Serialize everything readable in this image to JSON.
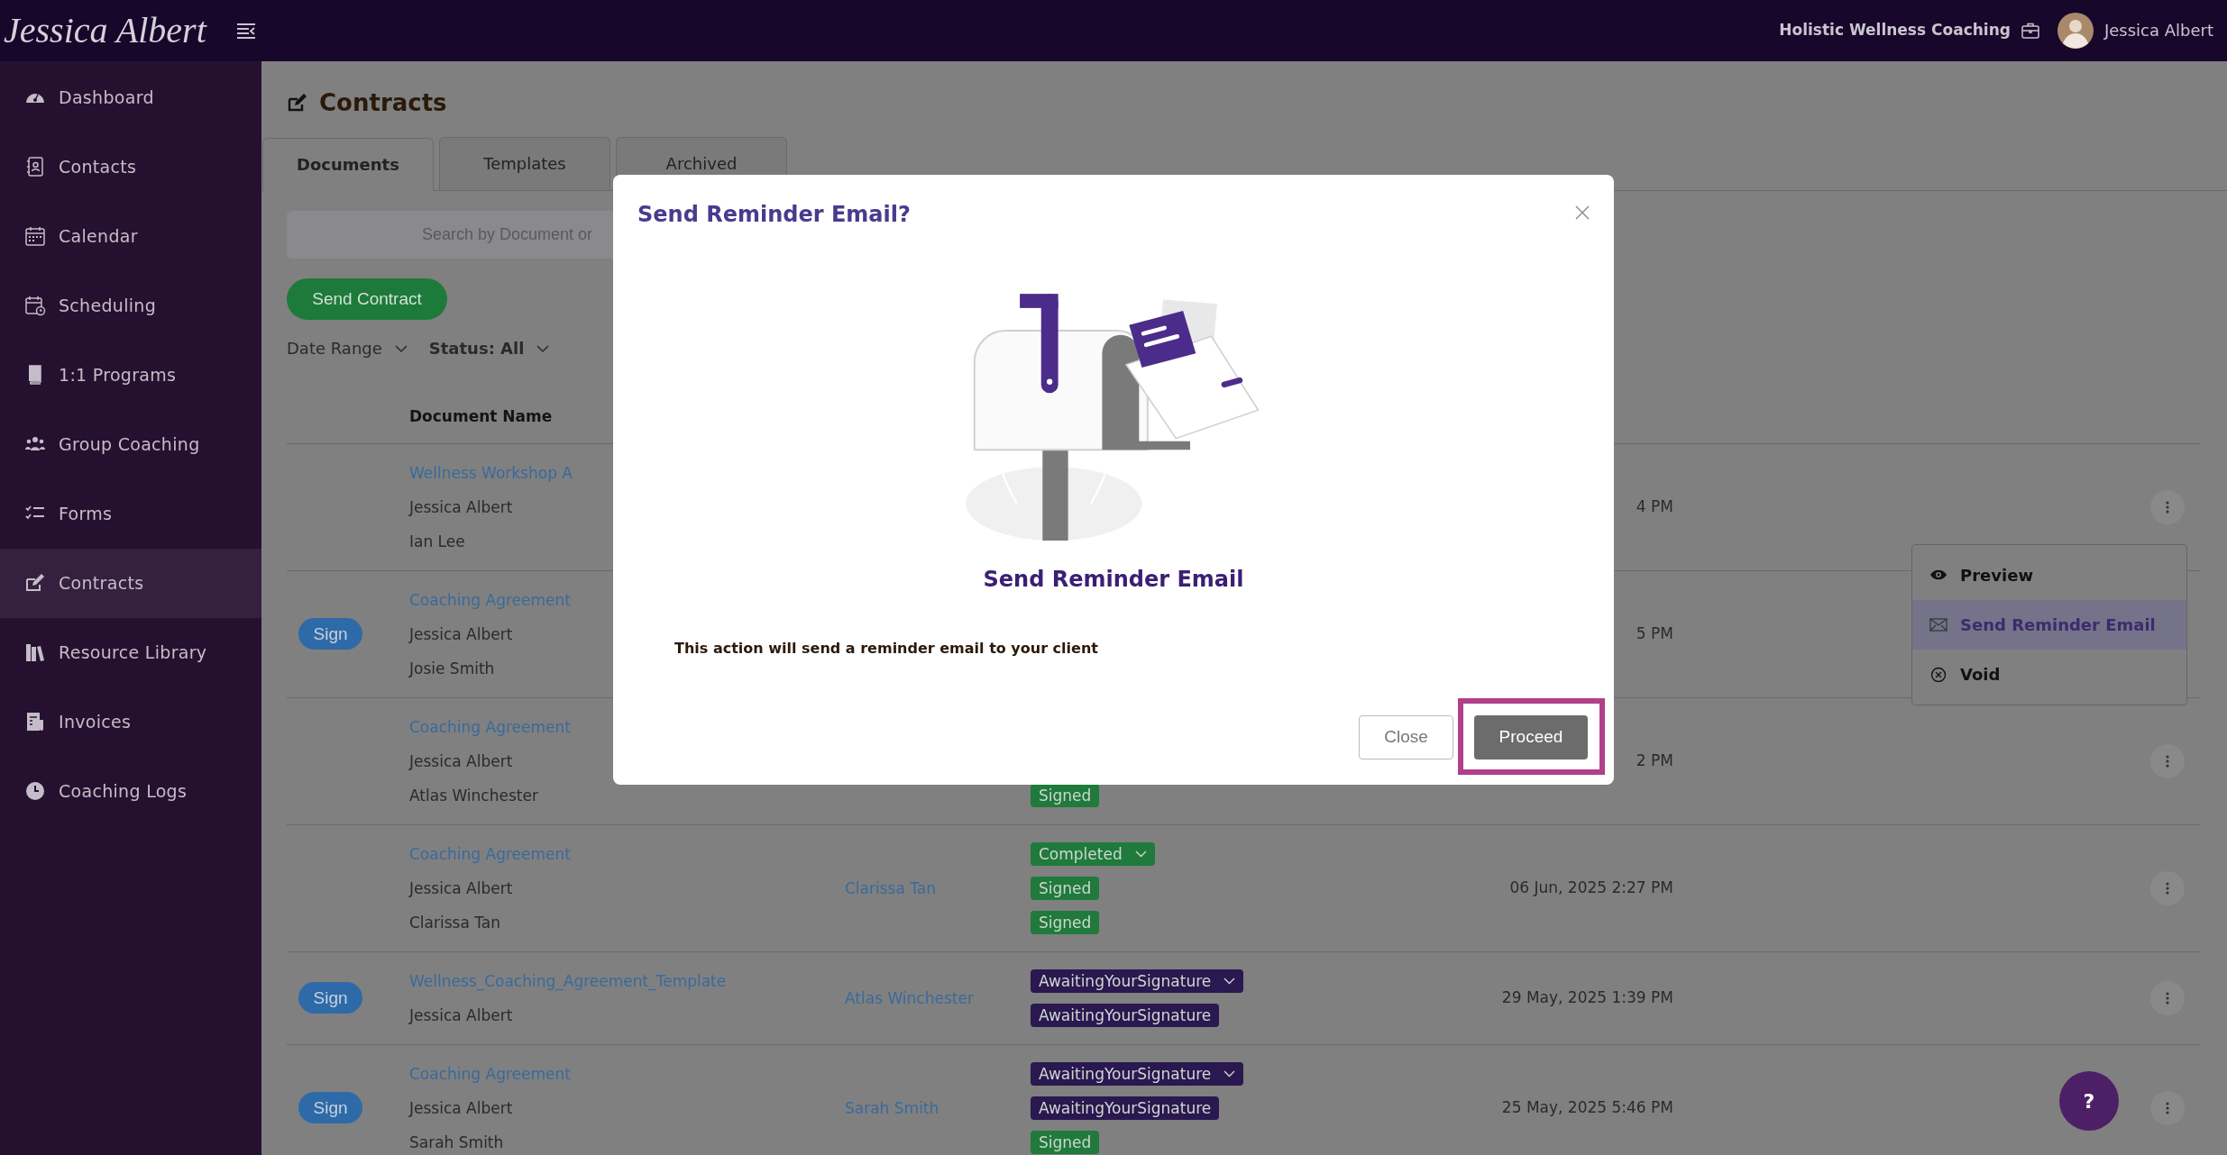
{
  "header": {
    "logo": "Jessica Albert",
    "business": "Holistic Wellness Coaching",
    "user": "Jessica Albert"
  },
  "sidebar": {
    "items": [
      {
        "label": "Dashboard",
        "selected": false
      },
      {
        "label": "Contacts",
        "selected": false
      },
      {
        "label": "Calendar",
        "selected": false
      },
      {
        "label": "Scheduling",
        "selected": false
      },
      {
        "label": "1:1 Programs",
        "selected": false
      },
      {
        "label": "Group Coaching",
        "selected": false
      },
      {
        "label": "Forms",
        "selected": false
      },
      {
        "label": "Contracts",
        "selected": true
      },
      {
        "label": "Resource Library",
        "selected": false
      },
      {
        "label": "Invoices",
        "selected": false
      },
      {
        "label": "Coaching Logs",
        "selected": false
      }
    ]
  },
  "page": {
    "title": "Contracts",
    "tabs": [
      {
        "label": "Documents",
        "selected": true
      },
      {
        "label": "Templates",
        "selected": false
      },
      {
        "label": "Archived",
        "selected": false
      }
    ],
    "search": {
      "placeholder": "Search by Document or"
    },
    "send_button": "Send Contract",
    "filters": [
      "Date Range",
      "Status: All"
    ]
  },
  "table": {
    "columns": [
      "Document Name"
    ],
    "rows": [
      {
        "document": "Wellness Workshop A",
        "signers": [
          "Jessica Albert",
          "Ian Lee"
        ],
        "statuses": [],
        "date": "4 PM",
        "menu": {
          "items": [
            {
              "label": "Preview",
              "selected": false
            },
            {
              "label": "Send Reminder Email",
              "selected": true
            },
            {
              "label": "Void",
              "selected": false
            }
          ]
        }
      },
      {
        "sign_button": "Sign",
        "document": "Coaching Agreement",
        "signers": [
          "Jessica Albert",
          "Josie Smith"
        ],
        "statuses": [],
        "date": "5 PM",
        "more_button": false
      },
      {
        "document": "Coaching Agreement",
        "signers": [
          "Jessica Albert",
          "Atlas Winchester"
        ],
        "statuses": [
          {
            "label": "Signed",
            "kind": "signed",
            "dropdown": false
          }
        ],
        "date": "2 PM"
      },
      {
        "document": "Coaching Agreement",
        "signers": [
          "Jessica Albert",
          "Clarissa Tan"
        ],
        "recipient": "Clarissa Tan",
        "statuses": [
          {
            "label": "Completed",
            "kind": "completed",
            "dropdown": true
          },
          {
            "label": "Signed",
            "kind": "signed",
            "dropdown": false
          },
          {
            "label": "Signed",
            "kind": "signed",
            "dropdown": false
          }
        ],
        "date": "06 Jun, 2025 2:27 PM"
      },
      {
        "sign_button": "Sign",
        "document": "Wellness_Coaching_Agreement_Template",
        "signers": [
          "Jessica Albert"
        ],
        "recipient": "Atlas Winchester",
        "statuses": [
          {
            "label": "AwaitingYourSignature",
            "kind": "awaiting",
            "dropdown": true
          },
          {
            "label": "AwaitingYourSignature",
            "kind": "awaiting",
            "dropdown": false
          }
        ],
        "date": "29 May, 2025 1:39 PM"
      },
      {
        "sign_button": "Sign",
        "document": "Coaching Agreement",
        "signers": [
          "Jessica Albert",
          "Sarah Smith"
        ],
        "recipient": "Sarah Smith",
        "statuses": [
          {
            "label": "AwaitingYourSignature",
            "kind": "awaiting",
            "dropdown": true
          },
          {
            "label": "AwaitingYourSignature",
            "kind": "awaiting",
            "dropdown": false
          },
          {
            "label": "Signed",
            "kind": "signed",
            "dropdown": false
          }
        ],
        "date": "25 May, 2025 5:46 PM"
      }
    ]
  },
  "modal": {
    "title": "Send Reminder Email?",
    "heading": "Send Reminder Email",
    "message": "This action will send a reminder email to your client",
    "buttons": [
      {
        "label": "Close",
        "kind": "secondary",
        "highlighted": false
      },
      {
        "label": "Proceed",
        "kind": "primary",
        "highlighted": true
      }
    ]
  },
  "help_button": "?"
}
